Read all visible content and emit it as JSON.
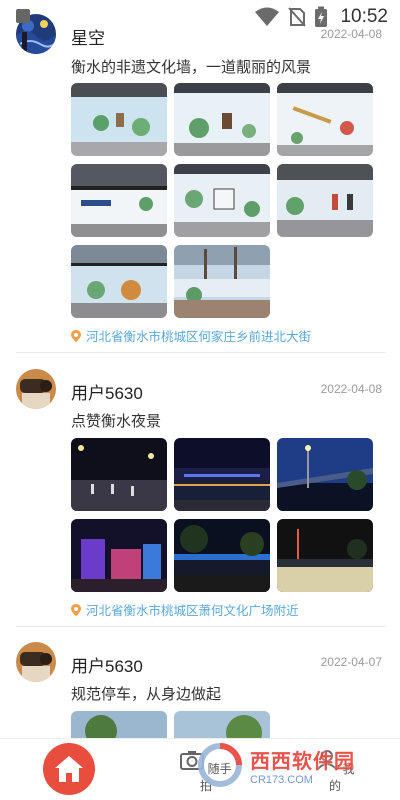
{
  "status_bar": {
    "time": "10:52",
    "icons": [
      "wifi-icon",
      "no-sim-icon",
      "battery-charging-icon"
    ]
  },
  "posts": [
    {
      "user": "星空",
      "date": "2022-04-08",
      "caption": "衡水的非遗文化墙，一道靓丽的风景",
      "location": "河北省衡水市桃城区何家庄乡前进北大街",
      "photo_count": 8
    },
    {
      "user": "用户5630",
      "date": "2022-04-08",
      "caption": "点赞衡水夜景",
      "location": "河北省衡水市桃城区萧何文化广场附近",
      "photo_count": 6
    },
    {
      "user": "用户5630",
      "date": "2022-04-07",
      "caption": "规范停车，从身边做起",
      "photo_count": 2
    }
  ],
  "bottom_nav": {
    "items": [
      {
        "label": "",
        "icon": "home-icon",
        "active": true
      },
      {
        "label": "随手拍",
        "icon": "camera-icon",
        "active": false
      },
      {
        "label": "我的",
        "icon": "user-icon",
        "active": false
      }
    ]
  },
  "watermark": {
    "text": "西西软件园",
    "sub": "CR173.COM"
  },
  "colors": {
    "accent": "#e84d3d",
    "location": "#5aa7d8",
    "date": "#9a9a9a"
  }
}
